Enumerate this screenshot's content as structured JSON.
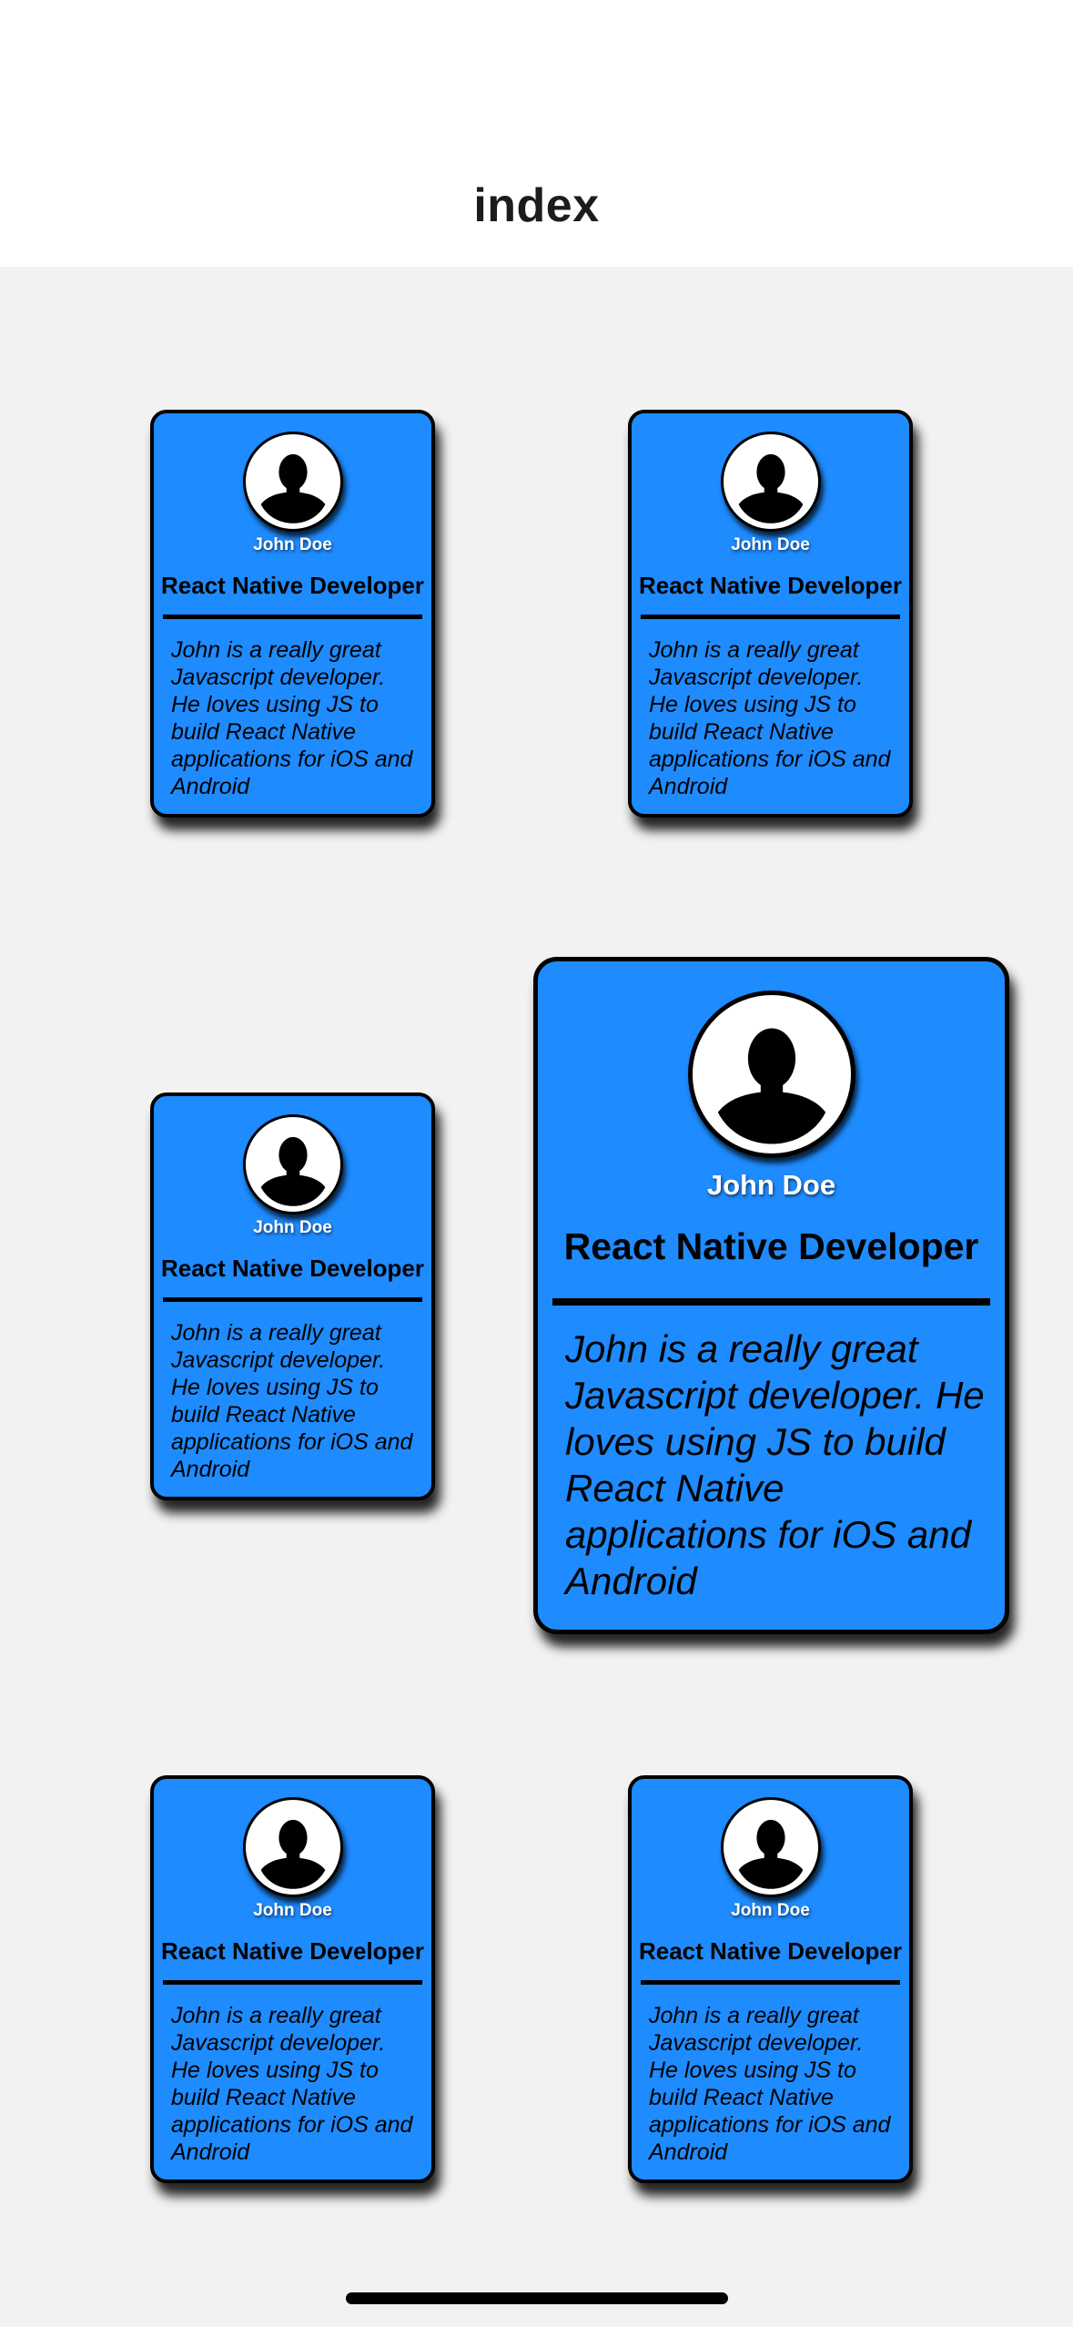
{
  "header": {
    "title": "index"
  },
  "cards": [
    {
      "name": "John Doe",
      "role": "React Native Developer",
      "bio": "John is a really great Javascript developer. He loves using JS to build React Native applications for iOS and Android"
    },
    {
      "name": "John Doe",
      "role": "React Native Developer",
      "bio": "John is a really great Javascript developer. He loves using JS to build React Native applications for iOS and Android"
    },
    {
      "name": "John Doe",
      "role": "React Native Developer",
      "bio": "John is a really great Javascript developer. He loves using JS to build React Native applications for iOS and Android"
    },
    {
      "name": "John Doe",
      "role": "React Native Developer",
      "bio": "John is a really great Javascript developer. He loves using JS to build React Native applications for iOS and Android"
    },
    {
      "name": "John Doe",
      "role": "React Native Developer",
      "bio": "John is a really great Javascript developer. He loves using JS to build React Native applications for iOS and Android"
    },
    {
      "name": "John Doe",
      "role": "React Native Developer",
      "bio": "John is a really great Javascript developer. He loves using JS to build React Native applications for iOS and Android"
    }
  ],
  "colors": {
    "card": "#1e8bff",
    "background": "#f2f2f2",
    "header": "#ffffff"
  },
  "icons": {
    "avatar": "user-silhouette-icon"
  }
}
